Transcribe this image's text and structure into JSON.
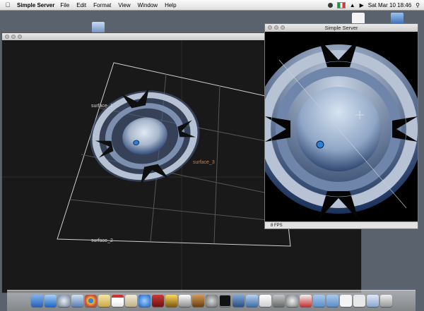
{
  "menubar": {
    "app_name": "Simple Server",
    "menus": [
      "File",
      "Edit",
      "Format",
      "View",
      "Window",
      "Help"
    ],
    "clock": "Sat Mar 10  18:46"
  },
  "preview_window": {
    "title": "Simple Server",
    "status": "8 FPS"
  },
  "main_window": {
    "surface_labels": {
      "surface_1": "surface_1",
      "surface_2": "surface_2",
      "surface_3": "surface_3"
    }
  },
  "colors": {
    "highlight_label": "#e07a2c",
    "marker": "#2f7fd6"
  },
  "dock": {
    "icons": [
      "finder-icon",
      "app-store-icon",
      "safari-icon",
      "preview-icon",
      "chrome-icon",
      "notes-icon",
      "calendar-icon",
      "script-icon",
      "itunes-icon",
      "photo-booth-icon",
      "imovie-icon",
      "pixelmator-icon",
      "guitar-icon",
      "preferences-icon",
      "terminal-icon",
      "grid-icon",
      "xcode-icon",
      "textedit-icon",
      "disk-utility-icon",
      "wheel-icon",
      "gmail-icon",
      "folder-icon",
      "folder-icon-2",
      "document-icon",
      "document-icon-2",
      "stack-icon",
      "trash-icon"
    ]
  }
}
